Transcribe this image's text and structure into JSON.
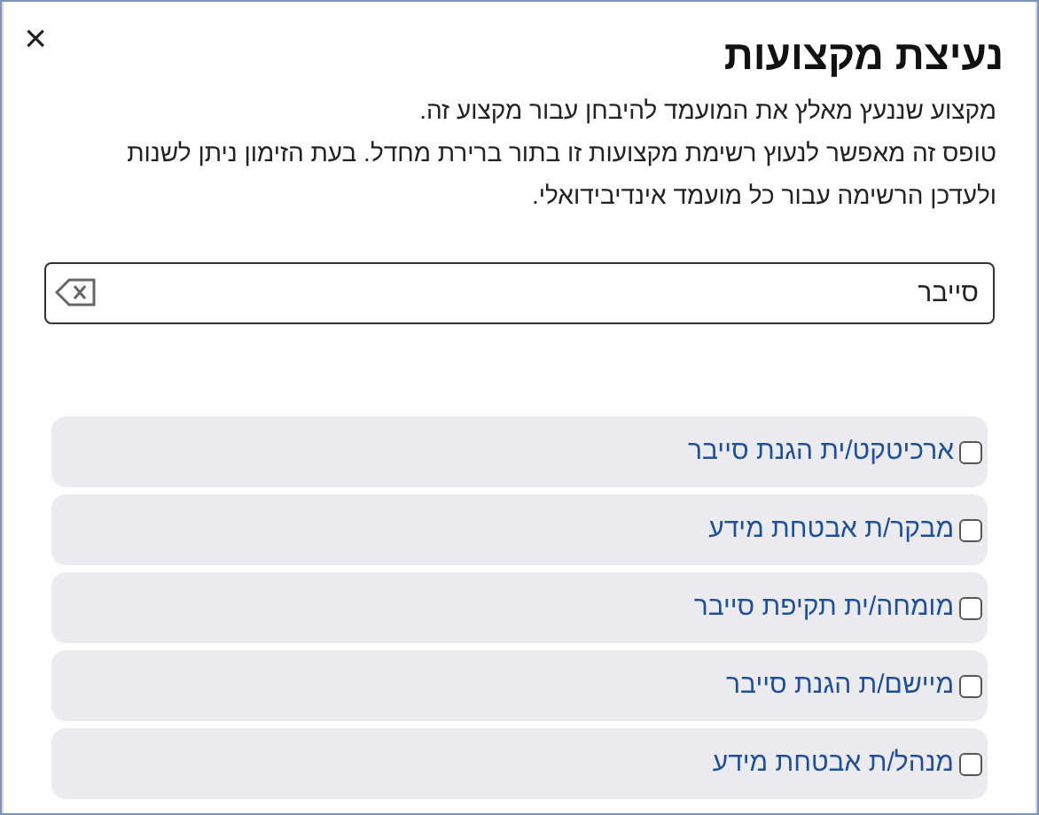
{
  "dialog": {
    "title": "נעיצת מקצועות",
    "close": "×",
    "paragraphs": [
      "מקצוע שננעץ מאלץ את המועמד להיבחן עבור מקצוע זה.",
      "טופס זה מאפשר לנעוץ רשימת מקצועות זו בתור ברירת מחדל. בעת הזימון ניתן לשנות ולעדכן הרשימה עבור כל מועמד אינדיבידואלי."
    ]
  },
  "search": {
    "value": "סייבר"
  },
  "professions": [
    {
      "label": "ארכיטקט/ית הגנת סייבר",
      "checked": false
    },
    {
      "label": "מבקר/ת אבטחת מידע",
      "checked": false
    },
    {
      "label": "מומחה/ית תקיפת סייבר",
      "checked": false
    },
    {
      "label": "מיישם/ת הגנת סייבר",
      "checked": false
    },
    {
      "label": "מנהל/ת אבטחת מידע",
      "checked": false
    }
  ]
}
